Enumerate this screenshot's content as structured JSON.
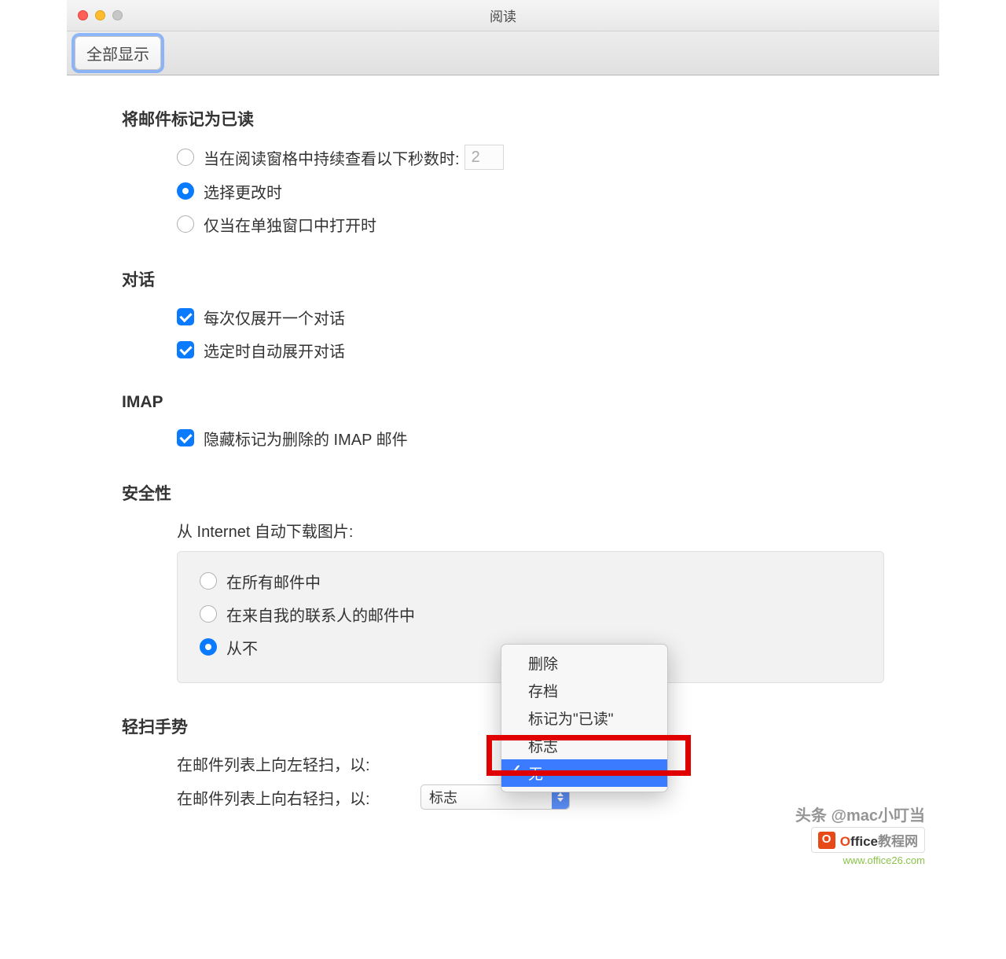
{
  "window": {
    "title": "阅读"
  },
  "toolbar": {
    "show_all": "全部显示"
  },
  "sections": {
    "mark_read": {
      "title": "将邮件标记为已读",
      "opt_seconds_label": "当在阅读窗格中持续查看以下秒数时:",
      "opt_seconds_value": "2",
      "opt_on_change": "选择更改时",
      "opt_separate_window": "仅当在单独窗口中打开时"
    },
    "conversation": {
      "title": "对话",
      "expand_one": "每次仅展开一个对话",
      "auto_expand": "选定时自动展开对话"
    },
    "imap": {
      "title": "IMAP",
      "hide_deleted": "隐藏标记为删除的 IMAP 邮件"
    },
    "security": {
      "title": "安全性",
      "auto_download_label": "从 Internet 自动下载图片:",
      "opt_all": "在所有邮件中",
      "opt_contacts": "在来自我的联系人的邮件中",
      "opt_never": "从不"
    },
    "swipe": {
      "title": "轻扫手势",
      "left_label": "在邮件列表上向左轻扫，以:",
      "right_label": "在邮件列表上向右轻扫，以:",
      "right_value": "标志",
      "dropdown": {
        "delete": "删除",
        "archive": "存档",
        "mark_read": "标记为\"已读\"",
        "flag": "标志",
        "none": "无"
      }
    }
  },
  "watermark": {
    "author": "头条 @mac小叮当",
    "brand": "ffice",
    "brand_sub": "教程网",
    "url": "www.office26.com"
  }
}
